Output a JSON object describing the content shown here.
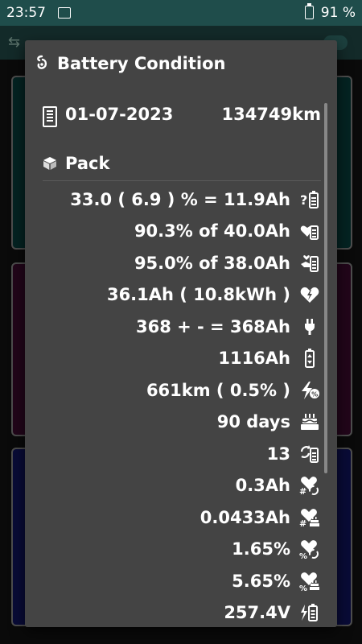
{
  "status_bar": {
    "time": "23:57",
    "battery_percent": "91 %"
  },
  "dialog": {
    "title": "Battery Condition",
    "date": "01-07-2023",
    "odometer": "134749km",
    "section_title": "Pack",
    "rows": [
      {
        "value": "33.0 ( 6.9 ) % = 11.9Ah",
        "icon": "battery-question-icon"
      },
      {
        "value": "90.3% of 40.0Ah",
        "icon": "heart-battery-icon"
      },
      {
        "value": "95.0% of 38.0Ah",
        "icon": "hand-battery-icon"
      },
      {
        "value": "36.1Ah ( 10.8kWh )",
        "icon": "heart-bolt-icon"
      },
      {
        "value": "368 + - = 368Ah",
        "icon": "plug-icon"
      },
      {
        "value": "1116Ah",
        "icon": "battery-updown-icon"
      },
      {
        "value": "661km ( 0.5% )",
        "icon": "lightning-percent-icon"
      },
      {
        "value": "90 days",
        "icon": "cake-icon"
      },
      {
        "value": "13",
        "icon": "battery-cycle-icon"
      },
      {
        "value": "0.3Ah",
        "icon": "heart-hash-cycle-icon"
      },
      {
        "value": "0.0433Ah",
        "icon": "heart-hash-cake-icon"
      },
      {
        "value": "1.65%",
        "icon": "heart-percent-cycle-icon"
      },
      {
        "value": "5.65%",
        "icon": "heart-percent-cake-icon"
      },
      {
        "value": "257.4V",
        "icon": "battery-voltage-icon"
      }
    ]
  },
  "colors": {
    "dialog_bg": "#444444",
    "card1": "#0b4f4d",
    "card2": "#4d0e3a",
    "card3": "#141a7a"
  }
}
